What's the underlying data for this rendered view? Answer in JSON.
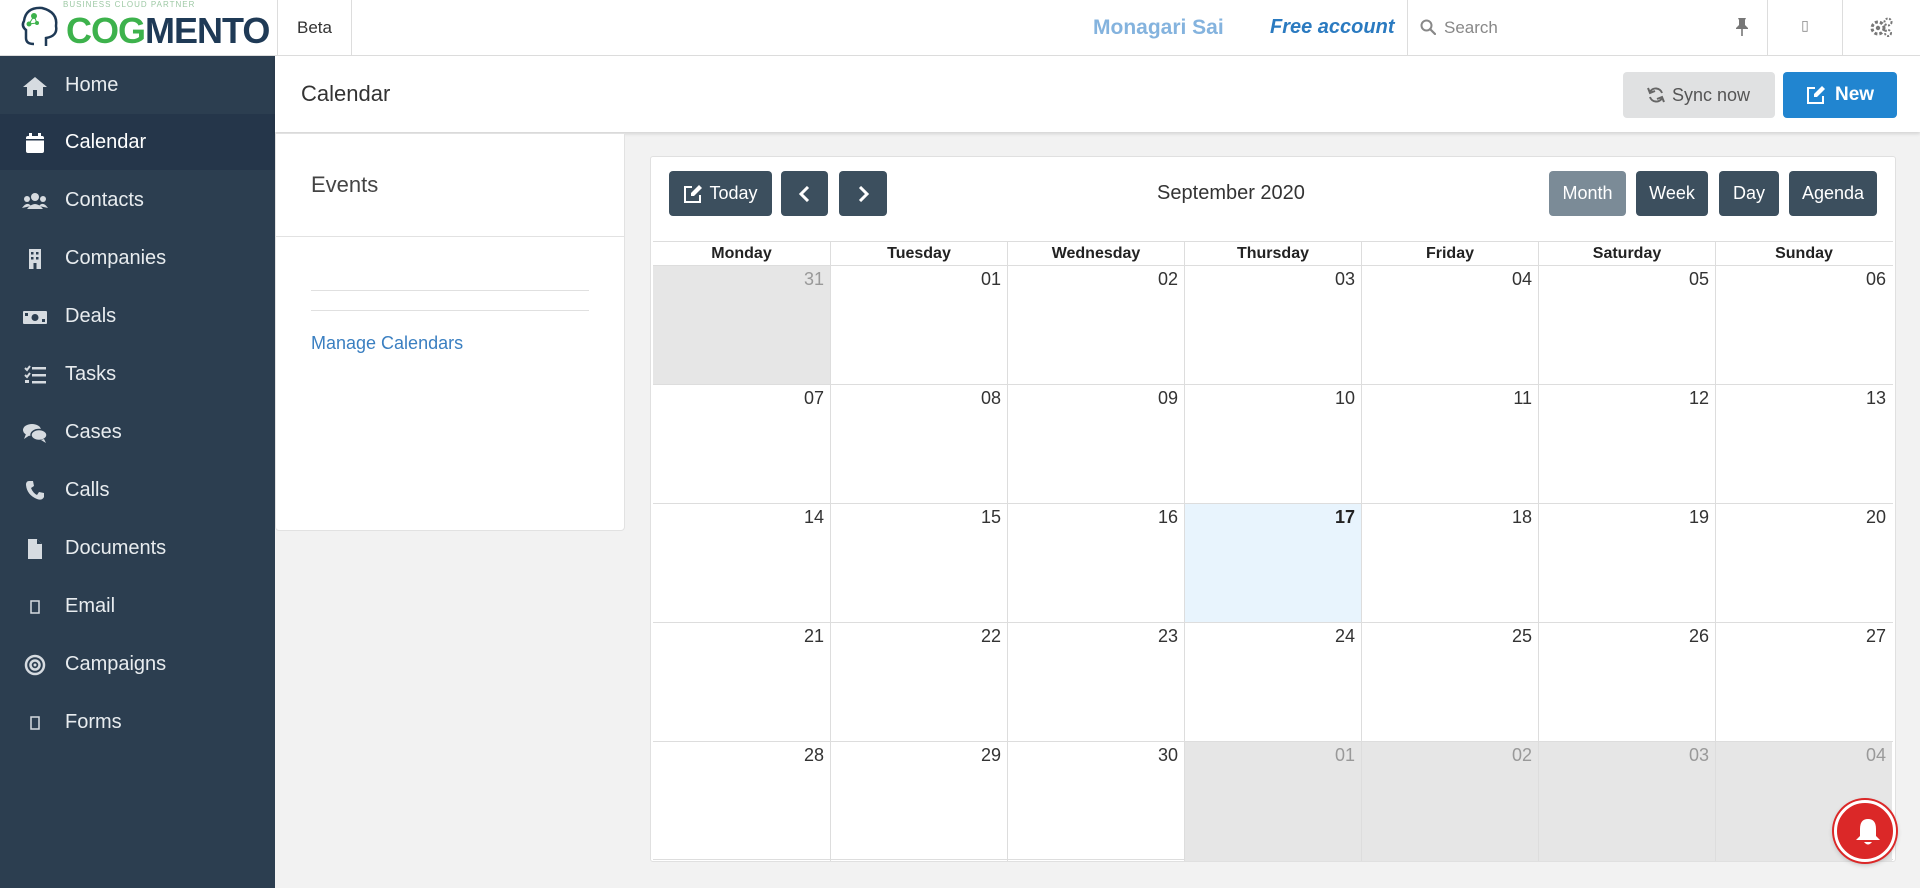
{
  "app": {
    "logo_tagline": "BUSINESS CLOUD PARTNER",
    "logo_text_light": "COG",
    "logo_text_dark": "MENTO",
    "badge": "Beta",
    "user_name": "Monagari Sai",
    "account_type": "Free account",
    "search_placeholder": "Search"
  },
  "sidebar": {
    "items": [
      {
        "label": "Home",
        "icon": "home-icon"
      },
      {
        "label": "Calendar",
        "icon": "calendar-icon",
        "active": true
      },
      {
        "label": "Contacts",
        "icon": "users-icon"
      },
      {
        "label": "Companies",
        "icon": "building-icon"
      },
      {
        "label": "Deals",
        "icon": "money-icon"
      },
      {
        "label": "Tasks",
        "icon": "tasks-icon"
      },
      {
        "label": "Cases",
        "icon": "comments-icon"
      },
      {
        "label": "Calls",
        "icon": "phone-icon"
      },
      {
        "label": "Documents",
        "icon": "file-icon"
      },
      {
        "label": "Email",
        "icon": "email-icon"
      },
      {
        "label": "Campaigns",
        "icon": "bullseye-icon"
      },
      {
        "label": "Forms",
        "icon": "forms-icon"
      }
    ]
  },
  "header": {
    "title": "Calendar",
    "sync_label": "Sync now",
    "new_label": "New"
  },
  "events_panel": {
    "title": "Events",
    "manage_link": "Manage Calendars"
  },
  "calendar": {
    "today_label": "Today",
    "month_title": "September 2020",
    "views": {
      "month": "Month",
      "week": "Week",
      "day": "Day",
      "agenda": "Agenda"
    },
    "active_view": "Month",
    "weekdays": [
      "Monday",
      "Tuesday",
      "Wednesday",
      "Thursday",
      "Friday",
      "Saturday",
      "Sunday"
    ],
    "weeks": [
      [
        {
          "d": "31",
          "other": true
        },
        {
          "d": "01"
        },
        {
          "d": "02"
        },
        {
          "d": "03"
        },
        {
          "d": "04"
        },
        {
          "d": "05"
        },
        {
          "d": "06"
        }
      ],
      [
        {
          "d": "07"
        },
        {
          "d": "08"
        },
        {
          "d": "09"
        },
        {
          "d": "10"
        },
        {
          "d": "11"
        },
        {
          "d": "12"
        },
        {
          "d": "13"
        }
      ],
      [
        {
          "d": "14"
        },
        {
          "d": "15"
        },
        {
          "d": "16"
        },
        {
          "d": "17",
          "today": true
        },
        {
          "d": "18"
        },
        {
          "d": "19"
        },
        {
          "d": "20"
        }
      ],
      [
        {
          "d": "21"
        },
        {
          "d": "22"
        },
        {
          "d": "23"
        },
        {
          "d": "24"
        },
        {
          "d": "25"
        },
        {
          "d": "26"
        },
        {
          "d": "27"
        }
      ],
      [
        {
          "d": "28"
        },
        {
          "d": "29"
        },
        {
          "d": "30"
        },
        {
          "d": "01",
          "other": true
        },
        {
          "d": "02",
          "other": true
        },
        {
          "d": "03",
          "other": true
        },
        {
          "d": "04",
          "other": true
        }
      ]
    ]
  },
  "colors": {
    "sidebar_bg": "#2c3e50",
    "primary_blue": "#2185d0",
    "logo_green": "#3db24c",
    "today_bg": "#e8f4fd",
    "notification_red": "#db2828"
  }
}
